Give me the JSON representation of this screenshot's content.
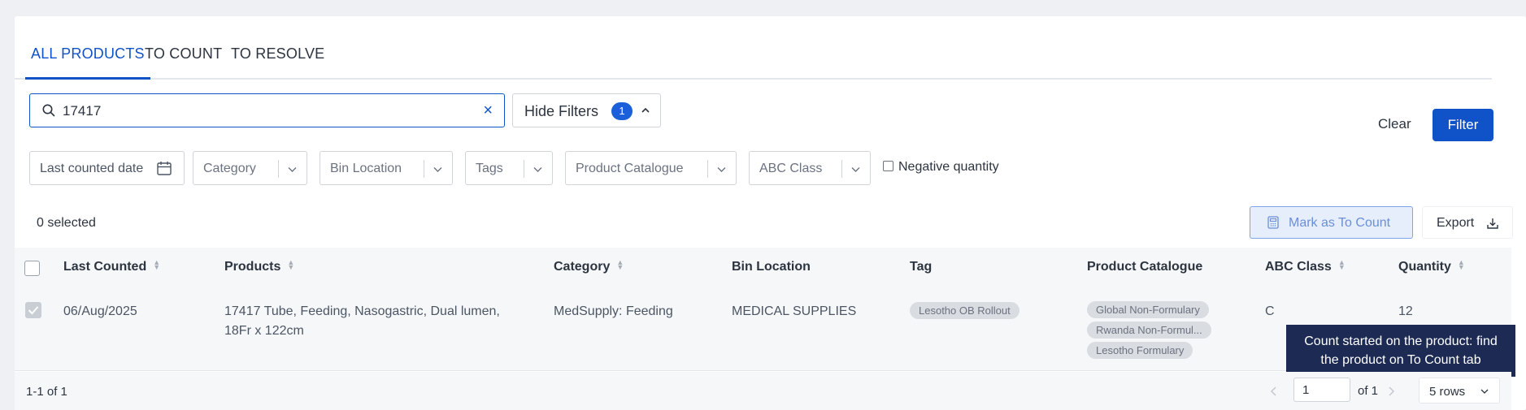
{
  "tabs": [
    {
      "label": "ALL PRODUCTS",
      "active": true
    },
    {
      "label": "TO COUNT",
      "active": false
    },
    {
      "label": "TO RESOLVE",
      "active": false
    }
  ],
  "search": {
    "value": "17417",
    "clear_icon": "close-icon",
    "icon": "search-icon"
  },
  "hide_filters": {
    "label": "Hide Filters",
    "badge": "1"
  },
  "actions": {
    "clear_label": "Clear",
    "filter_label": "Filter"
  },
  "filters": {
    "last_counted_date": "Last counted date",
    "category": "Category",
    "bin_location": "Bin Location",
    "tags": "Tags",
    "product_catalogue": "Product Catalogue",
    "abc_class": "ABC Class",
    "negative_quantity": "Negative quantity"
  },
  "selection": {
    "count_text": "0 selected",
    "mark_label": "Mark as To Count",
    "export_label": "Export"
  },
  "table": {
    "headers": {
      "last_counted": "Last Counted",
      "products": "Products",
      "category": "Category",
      "bin_location": "Bin Location",
      "tag": "Tag",
      "product_catalogue": "Product Catalogue",
      "abc_class": "ABC Class",
      "quantity": "Quantity"
    },
    "rows": [
      {
        "checked": true,
        "last_counted": "06/Aug/2025",
        "product_line1": "17417 Tube, Feeding, Nasogastric, Dual lumen,",
        "product_line2": "18Fr x 122cm",
        "category": "MedSupply: Feeding",
        "bin_location": "MEDICAL SUPPLIES",
        "tag": "Lesotho OB Rollout",
        "catalogues": [
          "Global Non-Formulary",
          "Rwanda Non-Formul...",
          "Lesotho Formulary"
        ],
        "abc_class": "C",
        "quantity": "12"
      }
    ]
  },
  "tooltip": {
    "line1": "Count started on the product: find",
    "line2": "the product on To Count tab"
  },
  "footer": {
    "range": "1-1 of 1",
    "page": "1",
    "of_pages": "of 1",
    "rows": "5 rows"
  },
  "colors": {
    "primary": "#1053c9",
    "tooltip_bg": "#1d2b54",
    "chip_bg": "#d9dce1"
  }
}
